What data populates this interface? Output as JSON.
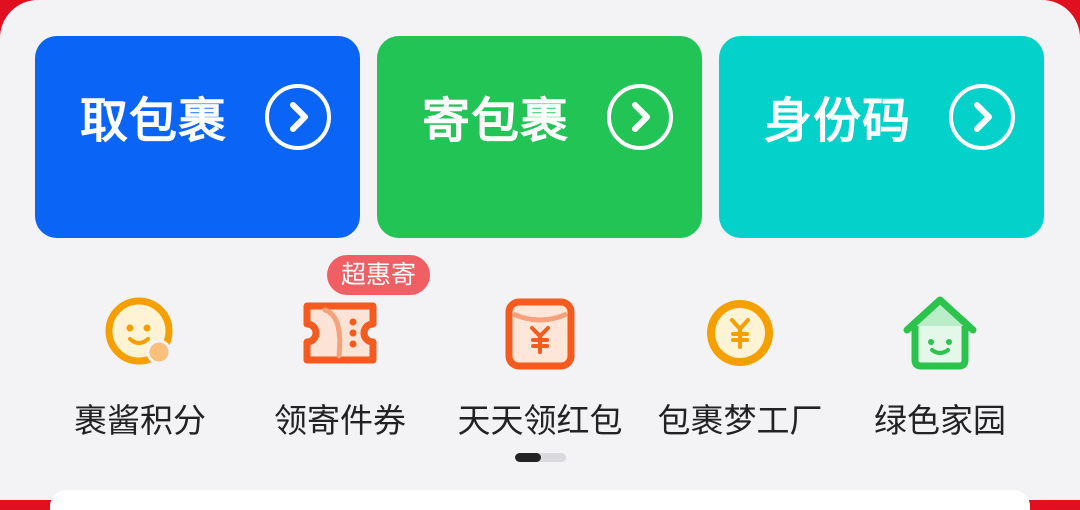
{
  "main_cards": [
    {
      "label": "取包裹",
      "color": "#0a64f5",
      "icon": "chevron-right-circle-icon"
    },
    {
      "label": "寄包裹",
      "color": "#22c455",
      "icon": "chevron-right-circle-icon"
    },
    {
      "label": "身份码",
      "color": "#04d1c9",
      "icon": "chevron-right-circle-icon"
    }
  ],
  "shortcuts": [
    {
      "label": "裹酱积分",
      "icon": "smiley-face-icon"
    },
    {
      "label": "领寄件券",
      "icon": "coupon-ticket-icon",
      "badge": "超惠寄"
    },
    {
      "label": "天天领红包",
      "icon": "red-envelope-icon"
    },
    {
      "label": "包裹梦工厂",
      "icon": "yuan-coin-icon"
    },
    {
      "label": "绿色家园",
      "icon": "green-house-icon"
    }
  ],
  "pager": {
    "current_page": 1,
    "page_count": 2
  },
  "colors": {
    "orange": "#f5a000",
    "red_orange": "#f55a1f",
    "green": "#2cc34d",
    "badge": "#f05f63"
  }
}
